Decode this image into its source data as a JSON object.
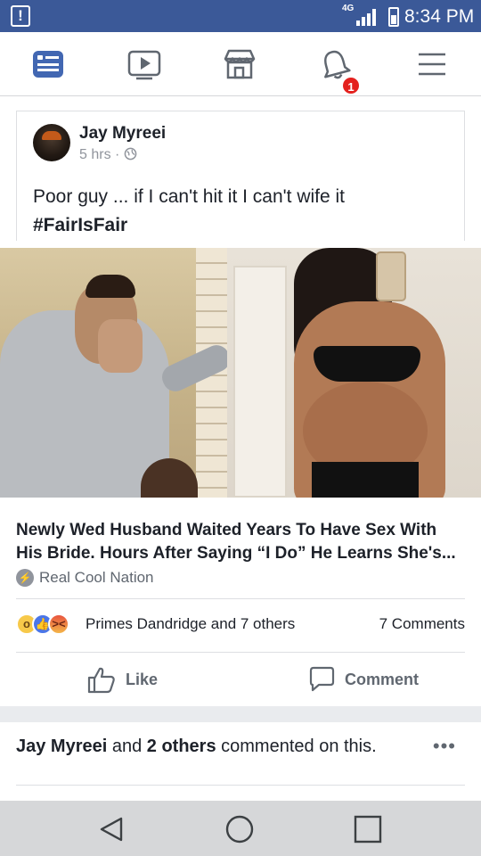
{
  "status_bar": {
    "network": "4G",
    "time": "8:34 PM",
    "icons": [
      "alert-icon",
      "signal-icon",
      "battery-icon"
    ]
  },
  "nav": {
    "tabs": [
      "news-feed-icon",
      "watch-icon",
      "marketplace-icon",
      "notifications-icon",
      "menu-icon"
    ],
    "notification_count": "1",
    "accent": "#4267b2"
  },
  "post": {
    "author": "Jay Myreei",
    "time": "5 hrs",
    "separator": "·",
    "privacy_icon": "globe-icon",
    "text": "Poor guy ... if I can't hit it I can't wife it",
    "hashtag": "#FairIsFair"
  },
  "link": {
    "title": "Newly Wed Husband Waited Years To Have Sex With His Bride. Hours After Saying “I Do” He Learns She's...",
    "source": "Real Cool Nation"
  },
  "engagement": {
    "reactions": [
      "wow",
      "like",
      "angry"
    ],
    "reactors": "Primes Dandridge and 7 others",
    "comments": "7 Comments"
  },
  "actions": {
    "like": "Like",
    "comment": "Comment"
  },
  "activity": {
    "name1": "Jay Myreei",
    "and": " and ",
    "name2": "2 others",
    "suffix": " commented on this.",
    "more": "•••"
  },
  "system_nav": [
    "back-icon",
    "home-icon",
    "recents-icon"
  ]
}
